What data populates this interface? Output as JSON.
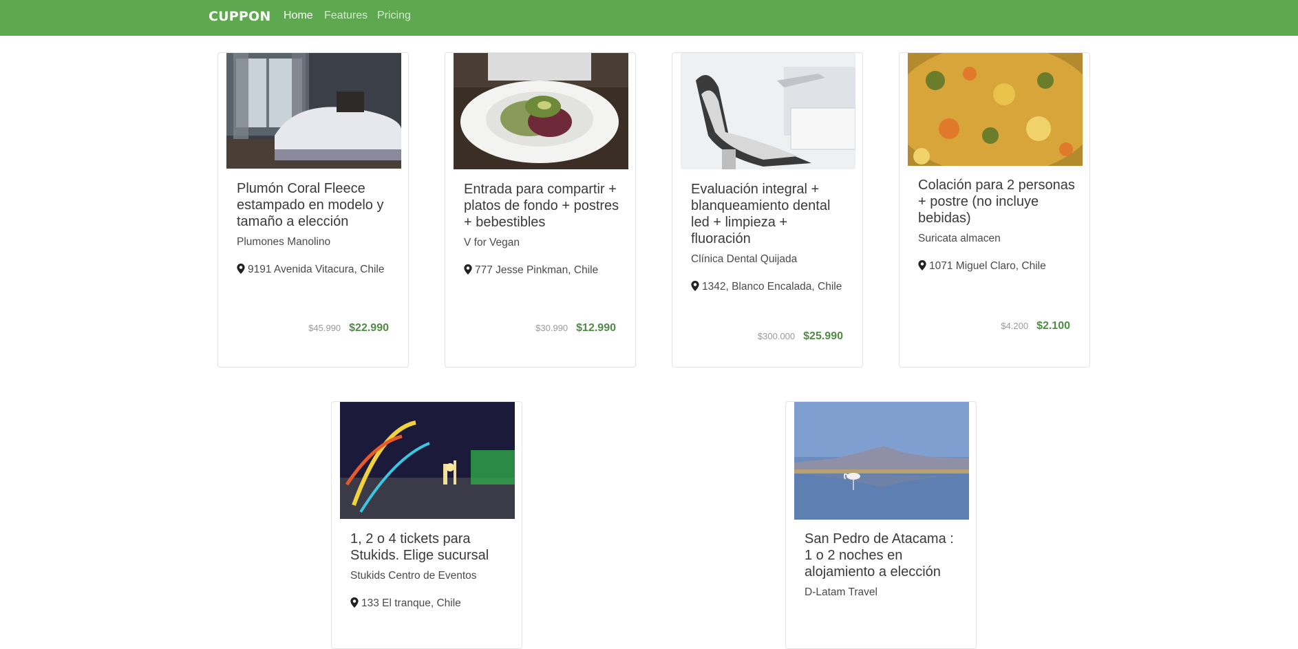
{
  "nav": {
    "brand": "CUPPON",
    "links": [
      {
        "label": "Home",
        "active": true
      },
      {
        "label": "Features",
        "active": false
      },
      {
        "label": "Pricing",
        "active": false
      }
    ]
  },
  "colors": {
    "navbar": "#5ea84f",
    "price": "#4f8b45",
    "old_price": "#9a9a9a"
  },
  "deals": [
    {
      "image": "bedroom-bed-photo",
      "title": "Plumón Coral Fleece estampado en modelo y tamaño a elección",
      "vendor": "Plumones Manolino",
      "location": "9191 Avenida Vitacura, Chile",
      "old_price": "$45.990",
      "price": "$22.990"
    },
    {
      "image": "vegan-salad-plate-photo",
      "title": "Entrada para compartir + platos de fondo + postres + bebestibles",
      "vendor": "V for Vegan",
      "location": "777 Jesse Pinkman, Chile",
      "old_price": "$30.990",
      "price": "$12.990"
    },
    {
      "image": "dental-chair-photo",
      "title": "Evaluación integral + blanqueamiento dental led + limpieza + fluoración",
      "vendor": "Clínica Dental Quijada",
      "location": "1342, Blanco Encalada, Chile",
      "old_price": "$300.000",
      "price": "$25.990"
    },
    {
      "image": "rice-dish-photo",
      "title": "Colación para 2 personas + postre (no incluye bebidas)",
      "vendor": "Suricata almacen",
      "location": "1071 Miguel Claro, Chile",
      "old_price": "$4.200",
      "price": "$2.100"
    },
    {
      "image": "amusement-park-night-photo",
      "title": "1, 2 o 4 tickets para Stukids. Elige sucursal",
      "vendor": "Stukids Centro de Eventos",
      "location": "133 El tranque, Chile"
    },
    {
      "image": "atacama-flamingo-lake-photo",
      "title": "San Pedro de Atacama : 1 o 2 noches en alojamiento a elección",
      "vendor": "D-Latam Travel"
    }
  ]
}
